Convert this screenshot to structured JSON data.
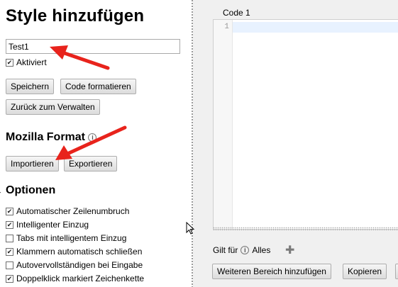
{
  "left": {
    "title": "Style hinzufügen",
    "name_input": {
      "value": "Test1"
    },
    "enabled": {
      "label": "Aktiviert",
      "checked": true
    },
    "buttons": {
      "save": "Speichern",
      "format_code": "Code formatieren",
      "back": "Zurück zum Verwalten"
    },
    "mozilla": {
      "heading": "Mozilla Format",
      "info_icon": "info-icon",
      "import": "Importieren",
      "export": "Exportieren"
    },
    "options": {
      "heading": "Optionen",
      "items": [
        {
          "label": "Automatischer Zeilenumbruch",
          "checked": true
        },
        {
          "label": "Intelligenter Einzug",
          "checked": true
        },
        {
          "label": "Tabs mit intelligentem Einzug",
          "checked": false
        },
        {
          "label": "Klammern automatisch schließen",
          "checked": true
        },
        {
          "label": "Autovervollständigen bei Eingabe",
          "checked": false
        },
        {
          "label": "Doppelklick markiert Zeichenkette",
          "checked": true
        }
      ]
    }
  },
  "right": {
    "code_label": "Code 1",
    "line_number": "1",
    "applies_label": "Gilt für",
    "applies_value": "Alles",
    "buttons": {
      "add_scope": "Weiteren Bereich hinzufügen",
      "copy": "Kopieren"
    }
  },
  "colors": {
    "annotation_arrow": "#e8231c"
  }
}
